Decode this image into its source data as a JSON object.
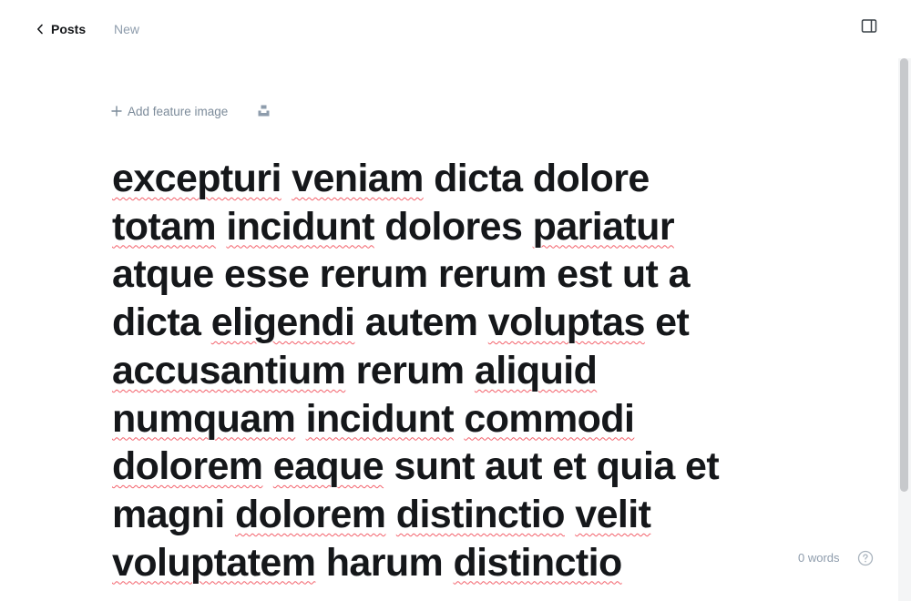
{
  "header": {
    "back_label": "Posts",
    "status": "New",
    "back_icon": "chevron-left-icon",
    "sidebar_icon": "sidebar-panel-icon"
  },
  "feature_image": {
    "add_label": "Add feature image",
    "add_icon": "plus-icon",
    "unsplash_icon": "unsplash-icon"
  },
  "editor": {
    "title_lines": [
      [
        {
          "w": "excepturi",
          "sp": true
        },
        {
          "w": "veniam",
          "sp": true
        },
        {
          "w": "dicta",
          "sp": false
        },
        {
          "w": "dolore",
          "sp": false
        }
      ],
      [
        {
          "w": "totam",
          "sp": true
        },
        {
          "w": "incidunt",
          "sp": true
        },
        {
          "w": "dolores",
          "sp": false
        },
        {
          "w": "pariatur",
          "sp": true
        }
      ],
      [
        {
          "w": "atque",
          "sp": false
        },
        {
          "w": "esse",
          "sp": false
        },
        {
          "w": "rerum",
          "sp": false
        },
        {
          "w": "rerum",
          "sp": false
        },
        {
          "w": "est",
          "sp": false
        },
        {
          "w": "ut",
          "sp": false
        },
        {
          "w": "a",
          "sp": false
        }
      ],
      [
        {
          "w": "dicta",
          "sp": false
        },
        {
          "w": "eligendi",
          "sp": true
        },
        {
          "w": "autem",
          "sp": false
        },
        {
          "w": "voluptas",
          "sp": true
        },
        {
          "w": "et",
          "sp": false
        }
      ],
      [
        {
          "w": "accusantium",
          "sp": true
        },
        {
          "w": "rerum",
          "sp": false
        },
        {
          "w": "aliquid",
          "sp": true
        }
      ],
      [
        {
          "w": "numquam",
          "sp": true
        },
        {
          "w": "incidunt",
          "sp": true
        },
        {
          "w": "commodi",
          "sp": true
        }
      ],
      [
        {
          "w": "dolorem",
          "sp": true
        },
        {
          "w": "eaque",
          "sp": true
        },
        {
          "w": "sunt",
          "sp": false
        },
        {
          "w": "aut",
          "sp": false
        },
        {
          "w": "et",
          "sp": false
        },
        {
          "w": "quia",
          "sp": false
        },
        {
          "w": "et",
          "sp": false
        }
      ],
      [
        {
          "w": "magni",
          "sp": false
        },
        {
          "w": "dolorem",
          "sp": true
        },
        {
          "w": "distinctio",
          "sp": true
        },
        {
          "w": "velit",
          "sp": true
        }
      ],
      [
        {
          "w": "voluptatem",
          "sp": true
        },
        {
          "w": "harum",
          "sp": false
        },
        {
          "w": "distinctio",
          "sp": true
        }
      ]
    ]
  },
  "footer": {
    "word_count": "0 words",
    "help_icon": "help-circle-icon"
  },
  "colors": {
    "text": "#15171a",
    "muted": "#8e9cac",
    "spellcheck": "#f3606a"
  }
}
